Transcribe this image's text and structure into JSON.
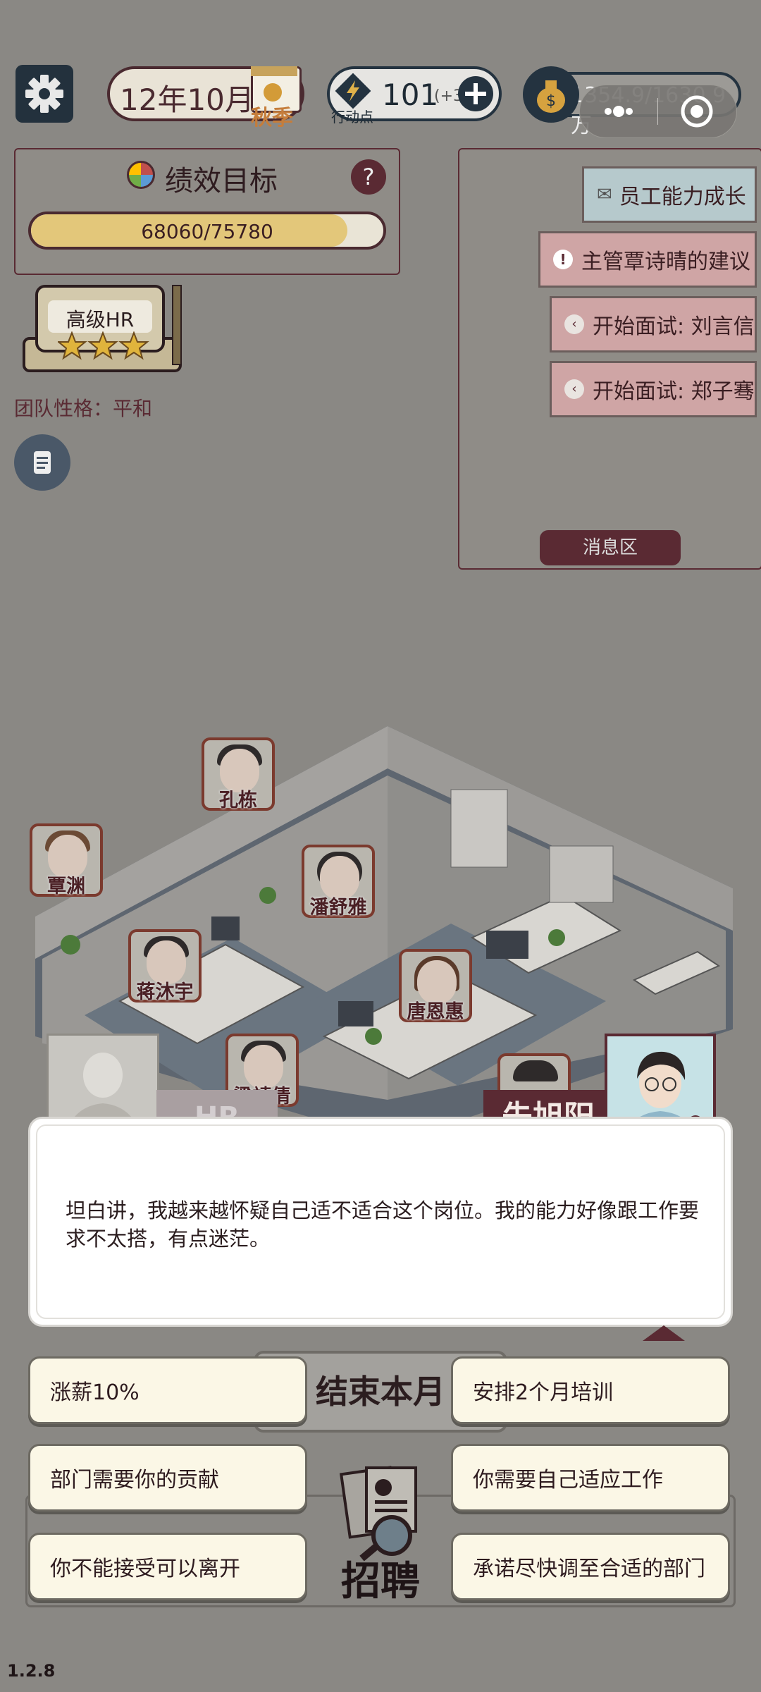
{
  "top_bar": {
    "date": "12年10月",
    "season": "秋季",
    "action_points": "101",
    "action_points_bonus": "(+3",
    "action_points_label": "行动点",
    "money": "1354.9/1630.9万"
  },
  "performance": {
    "title": "绩效目标",
    "help": "?",
    "progress_text": "68060/75780",
    "progress_fraction": 0.898
  },
  "rank": {
    "title": "高级HR",
    "stars": 3
  },
  "team": {
    "personality_label": "团队性格：",
    "personality_value": "平和"
  },
  "messages": {
    "items": [
      {
        "label": "员工能力成长",
        "icon": "mail-icon"
      },
      {
        "label": "主管覃诗晴的建议",
        "icon": "alert-icon"
      },
      {
        "label": "开始面试: 刘言信",
        "icon": "back-icon"
      },
      {
        "label": "开始面试: 郑子骞",
        "icon": "back-icon"
      }
    ],
    "area_label": "消息区"
  },
  "office": {
    "employees": [
      "孔栋",
      "覃渊",
      "潘舒雅",
      "蒋沐宇",
      "唐恩惠",
      "梁靖倩"
    ]
  },
  "dialog": {
    "left_speaker": "HR",
    "right_speaker": "朱旭阳",
    "text": "坦白讲，我越来越怀疑自己适不适合这个岗位。我的能力好像跟工作要求不太搭，有点迷茫。"
  },
  "choices": [
    "涨薪10%",
    "安排2个月培训",
    "部门需要你的贡献",
    "你需要自己适应工作",
    "你不能接受可以离开",
    "承诺尽快调至合适的部门"
  ],
  "bottom": {
    "end_month": "结束本月",
    "recruit": "招聘",
    "version": "1.2.8"
  },
  "colors": {
    "accent": "#5a2a33",
    "progress_fill": "#e3c77a",
    "choice_bg": "#fbf7e6"
  }
}
